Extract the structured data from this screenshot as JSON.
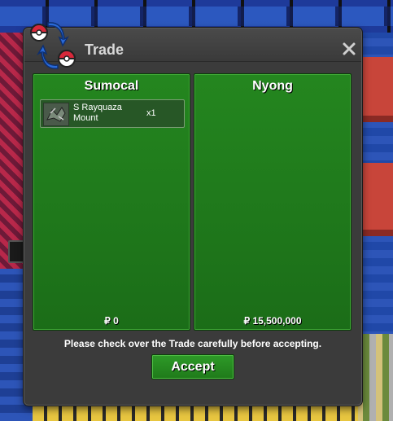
{
  "window": {
    "title": "Trade",
    "close_icon": "close-icon"
  },
  "left_panel": {
    "player": "Sumocal",
    "items": [
      {
        "name": "S Rayquaza Mount",
        "quantity": "x1",
        "icon": "rayquaza-mount-icon"
      }
    ],
    "money": "₽ 0"
  },
  "right_panel": {
    "player": "Nyong",
    "items": [],
    "money": "₽ 15,500,000"
  },
  "notice": "Please check over the Trade carefully before accepting.",
  "accept_label": "Accept",
  "colors": {
    "panel_green": "#24861f",
    "window_bg": "#3b3b3b",
    "accept_green": "#2e9a28"
  }
}
